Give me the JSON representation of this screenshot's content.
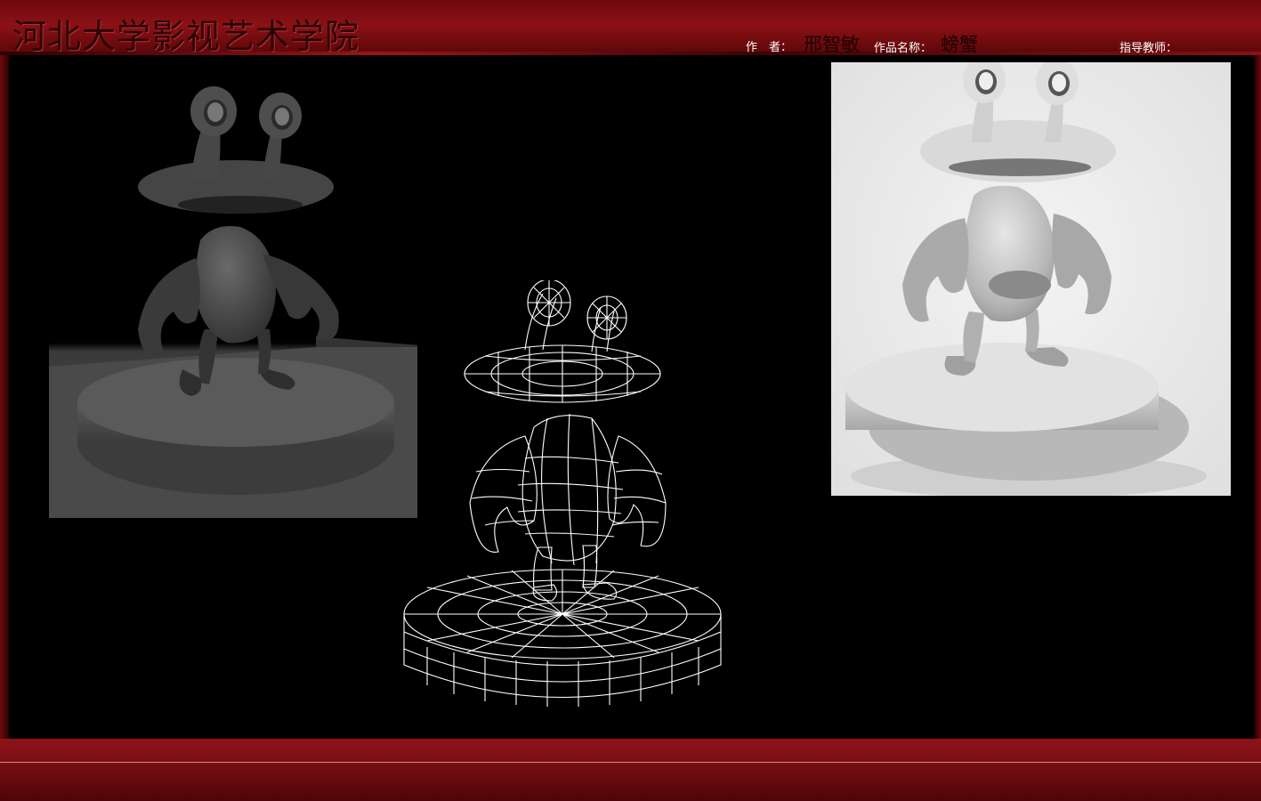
{
  "header": {
    "school_title": "河北大学影视艺术学院",
    "author_label": "作　者：",
    "author_name": "邢智敏",
    "work_label": "作品名称：",
    "work_name": "螃蟹",
    "teacher_label": "指导教师："
  },
  "renders": [
    {
      "style": "shaded-dark"
    },
    {
      "style": "wireframe"
    },
    {
      "style": "shaded-light"
    }
  ],
  "colors": {
    "frame_red": "#8b1116",
    "background": "#000000"
  }
}
